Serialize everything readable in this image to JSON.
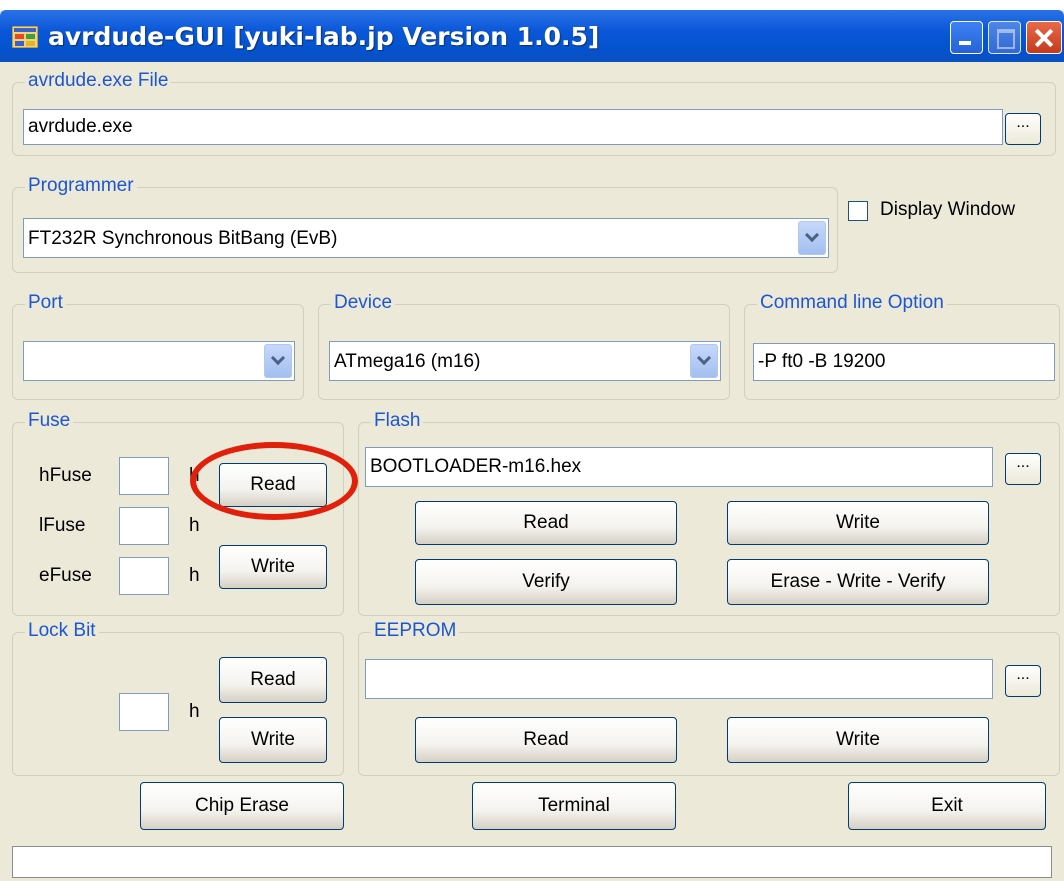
{
  "window": {
    "title": "avrdude-GUI [yuki-lab.jp Version 1.0.5]"
  },
  "avrdude_file": {
    "label": "avrdude.exe File",
    "value": "avrdude.exe",
    "browse_label": "..."
  },
  "programmer": {
    "label": "Programmer",
    "selected": "FT232R Synchronous BitBang (EvB)"
  },
  "display_window": {
    "label": "Display Window",
    "checked": false
  },
  "port": {
    "label": "Port",
    "selected": ""
  },
  "device": {
    "label": "Device",
    "selected": "ATmega16 (m16)"
  },
  "command_line": {
    "label": "Command line Option",
    "value": "-P ft0 -B 19200"
  },
  "fuse": {
    "label": "Fuse",
    "hfuse_label": "hFuse",
    "lfuse_label": "lFuse",
    "efuse_label": "eFuse",
    "hex_suffix": "h",
    "read_label": "Read",
    "write_label": "Write"
  },
  "flash": {
    "label": "Flash",
    "value": "BOOTLOADER-m16.hex",
    "browse_label": "...",
    "read_label": "Read",
    "write_label": "Write",
    "verify_label": "Verify",
    "erase_write_verify_label": "Erase - Write - Verify"
  },
  "lock_bit": {
    "label": "Lock Bit",
    "hex_suffix": "h",
    "read_label": "Read",
    "write_label": "Write"
  },
  "eeprom": {
    "label": "EEPROM",
    "value": "",
    "browse_label": "...",
    "read_label": "Read",
    "write_label": "Write"
  },
  "bottom": {
    "chip_erase_label": "Chip Erase",
    "terminal_label": "Terminal",
    "exit_label": "Exit"
  },
  "colors": {
    "titlebar": "#0453cf",
    "group_label": "#1d56d2",
    "window_bg": "#ece9d8",
    "highlight": "#e0200a"
  }
}
